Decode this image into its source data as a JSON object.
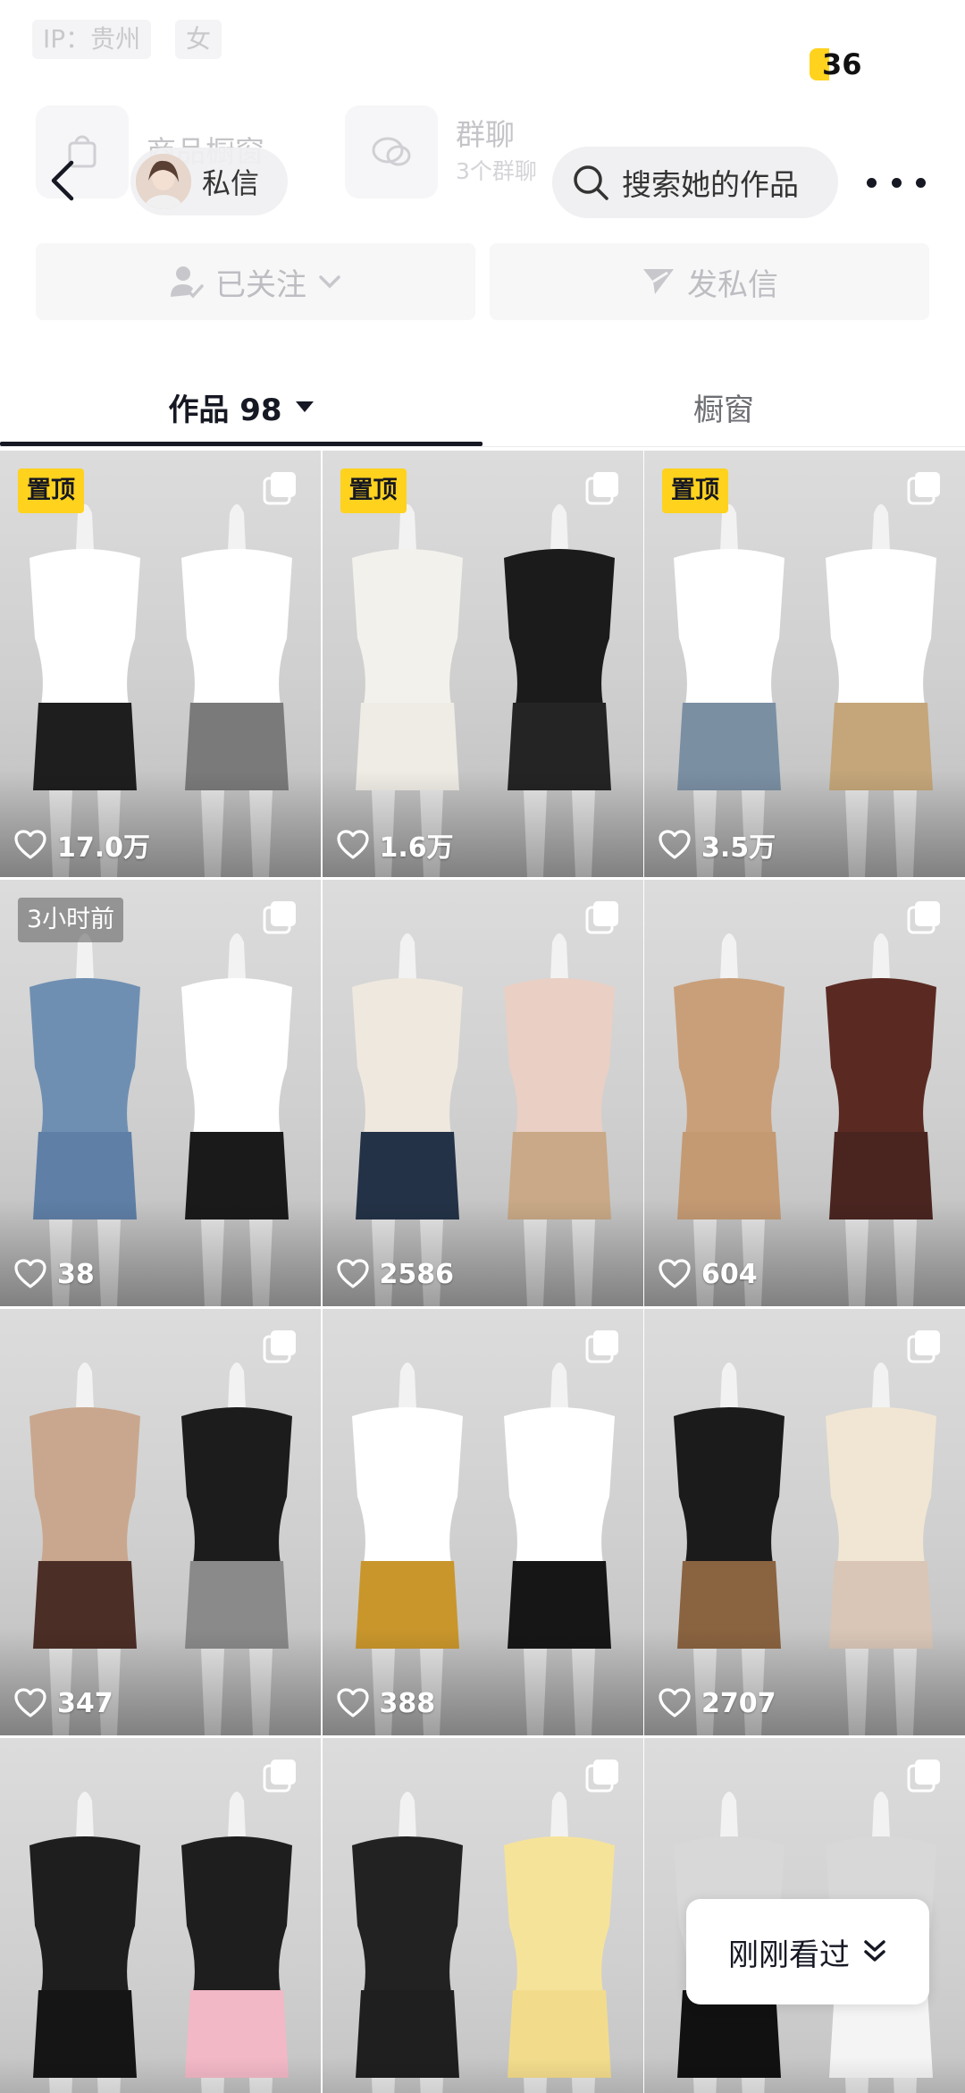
{
  "status": {
    "battery": "36"
  },
  "profile_bg": {
    "ip_tag": "IP：贵州",
    "gender_tag": "女",
    "shop_title": "商品橱窗",
    "group_title": "群聊",
    "group_sub": "3个群聊"
  },
  "topbar": {
    "message_label": "私信",
    "search_label": "搜索她的作品"
  },
  "actions": {
    "followed_label": "已关注",
    "send_message_label": "发私信"
  },
  "tabs": {
    "works_label": "作品 98",
    "showcase_label": "橱窗"
  },
  "grid": {
    "items": [
      {
        "badge": "置顶",
        "badge_type": "pin",
        "likes": "17.0万"
      },
      {
        "badge": "置顶",
        "badge_type": "pin",
        "likes": "1.6万"
      },
      {
        "badge": "置顶",
        "badge_type": "pin",
        "likes": "3.5万"
      },
      {
        "badge": "3小时前",
        "badge_type": "time",
        "likes": "38"
      },
      {
        "badge": "",
        "badge_type": "none",
        "likes": "2586"
      },
      {
        "badge": "",
        "badge_type": "none",
        "likes": "604"
      },
      {
        "badge": "",
        "badge_type": "none",
        "likes": "347"
      },
      {
        "badge": "",
        "badge_type": "none",
        "likes": "388"
      },
      {
        "badge": "",
        "badge_type": "none",
        "likes": "2707"
      },
      {
        "badge": "",
        "badge_type": "none",
        "likes": ""
      },
      {
        "badge": "",
        "badge_type": "none",
        "likes": ""
      },
      {
        "badge": "",
        "badge_type": "none",
        "likes": ""
      }
    ]
  },
  "recent": {
    "label": "刚刚看过"
  },
  "colors": {
    "pin_badge": "#ffd21e",
    "text_primary": "#161823",
    "muted": "#bdbdc2"
  },
  "icons": [
    "chevron-left-icon",
    "search-icon",
    "more-icon",
    "person-check-icon",
    "chevron-down-icon",
    "send-icon",
    "caret-down-icon",
    "multi-image-icon",
    "heart-icon",
    "double-chevron-down-icon"
  ]
}
